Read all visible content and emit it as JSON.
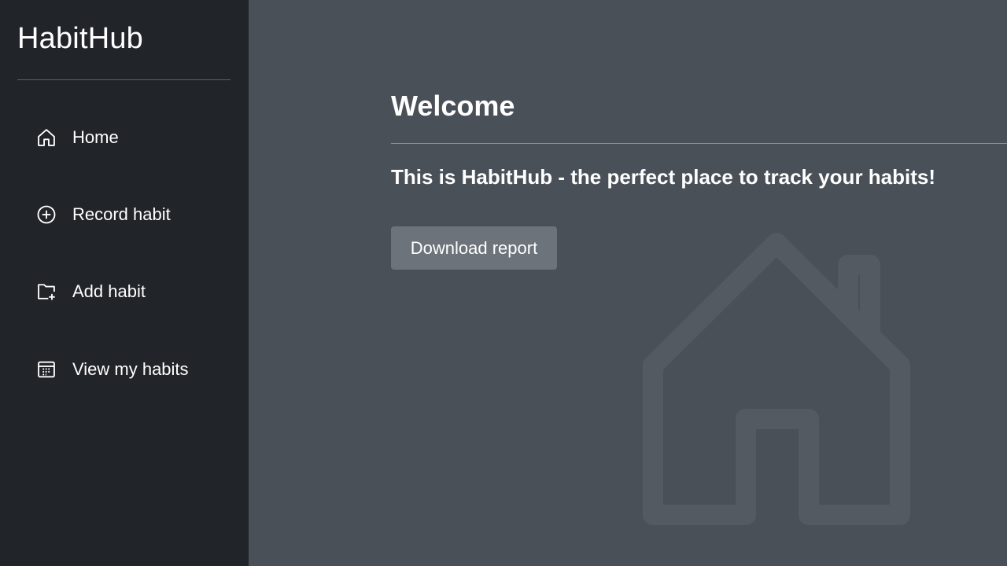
{
  "sidebar": {
    "brand": "HabitHub",
    "items": [
      {
        "label": "Home",
        "icon": "home-icon"
      },
      {
        "label": "Record habit",
        "icon": "plus-circle-icon"
      },
      {
        "label": "Add habit",
        "icon": "folder-plus-icon"
      },
      {
        "label": "View my habits",
        "icon": "calendar-icon"
      }
    ]
  },
  "main": {
    "title": "Welcome",
    "lead": "This is HabitHub - the perfect place to track your habits!",
    "download_button": "Download report",
    "background_icon": "home-icon"
  },
  "colors": {
    "sidebar_bg": "#212429",
    "main_bg": "#4a5058",
    "button_bg": "#6c737b",
    "text": "#ffffff"
  }
}
